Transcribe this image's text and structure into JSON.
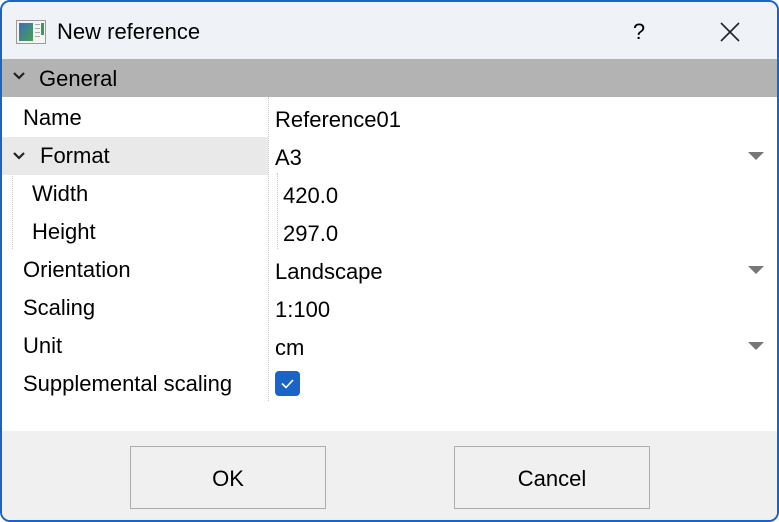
{
  "window": {
    "title": "New reference",
    "title_icon": "window-icon",
    "help_label": "?",
    "close_icon": "close-icon"
  },
  "properties": {
    "section_label": "General",
    "rows": [
      {
        "name": "Name",
        "value": "Reference01",
        "type": "text"
      },
      {
        "name": "Format",
        "value": "A3",
        "type": "dropdown",
        "expanded": true
      },
      {
        "name": "Width",
        "value": "420.0",
        "type": "text",
        "child_of": "Format"
      },
      {
        "name": "Height",
        "value": "297.0",
        "type": "text",
        "child_of": "Format"
      },
      {
        "name": "Orientation",
        "value": "Landscape",
        "type": "dropdown"
      },
      {
        "name": "Scaling",
        "value": "1:100",
        "type": "text"
      },
      {
        "name": "Unit",
        "value": "cm",
        "type": "dropdown"
      },
      {
        "name": "Supplemental scaling",
        "value": "checked",
        "type": "checkbox",
        "checked": true
      }
    ]
  },
  "buttons": {
    "ok_label": "OK",
    "cancel_label": "Cancel"
  },
  "colors": {
    "accent": "#1a64c8",
    "section_bg": "#b3b3b3",
    "footer_bg": "#f0f0f0"
  }
}
